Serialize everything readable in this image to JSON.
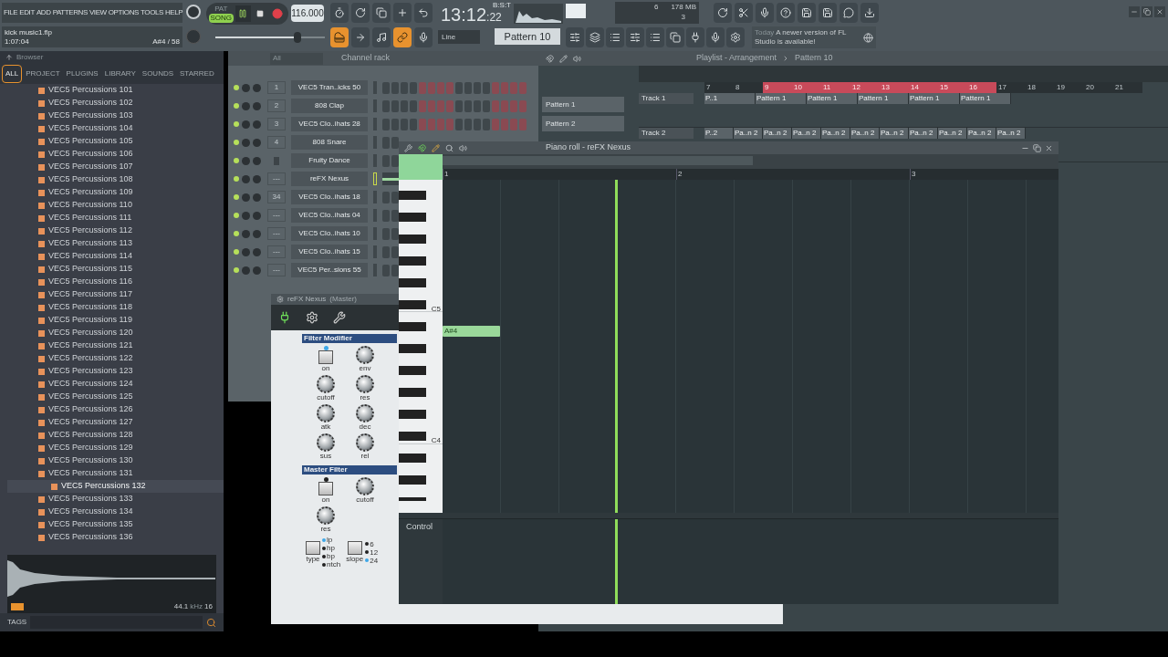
{
  "menu": [
    "FILE",
    "EDIT",
    "ADD",
    "PATTERNS",
    "VIEW",
    "OPTIONS",
    "TOOLS",
    "HELP"
  ],
  "project": {
    "file": "kick music1.flp",
    "time": "1:07:04",
    "note": "A#4 / 58"
  },
  "master_volume": {
    "level": 0.75
  },
  "transport": {
    "modes": [
      {
        "label": "PAT",
        "selected": false
      },
      {
        "label": "SONG",
        "selected": true
      }
    ],
    "playing": true,
    "tempo": "116.000"
  },
  "clock": {
    "main": "13:12",
    "small": ":22",
    "unit": "B:S:T"
  },
  "monitor": {
    "voices": "6",
    "memory": "178 MB",
    "poly": "3"
  },
  "snap": "Line",
  "pattern": "Pattern 10",
  "news": {
    "when": "Today",
    "text": "A newer version of FL Studio is available!"
  },
  "browser": {
    "title": "Browser",
    "tabs": [
      {
        "label": "ALL",
        "selected": true
      },
      {
        "label": "PROJECT",
        "selected": false
      },
      {
        "label": "PLUGINS",
        "selected": false
      },
      {
        "label": "LIBRARY",
        "selected": false
      },
      {
        "label": "SOUNDS",
        "selected": false
      },
      {
        "label": "STARRED",
        "selected": false
      }
    ],
    "items": [
      {
        "name": "VEC5 Percussions 101",
        "selected": false
      },
      {
        "name": "VEC5 Percussions 102",
        "selected": false
      },
      {
        "name": "VEC5 Percussions 103",
        "selected": false
      },
      {
        "name": "VEC5 Percussions 104",
        "selected": false
      },
      {
        "name": "VEC5 Percussions 105",
        "selected": false
      },
      {
        "name": "VEC5 Percussions 106",
        "selected": false
      },
      {
        "name": "VEC5 Percussions 107",
        "selected": false
      },
      {
        "name": "VEC5 Percussions 108",
        "selected": false
      },
      {
        "name": "VEC5 Percussions 109",
        "selected": false
      },
      {
        "name": "VEC5 Percussions 110",
        "selected": false
      },
      {
        "name": "VEC5 Percussions 111",
        "selected": false
      },
      {
        "name": "VEC5 Percussions 112",
        "selected": false
      },
      {
        "name": "VEC5 Percussions 113",
        "selected": false
      },
      {
        "name": "VEC5 Percussions 114",
        "selected": false
      },
      {
        "name": "VEC5 Percussions 115",
        "selected": false
      },
      {
        "name": "VEC5 Percussions 116",
        "selected": false
      },
      {
        "name": "VEC5 Percussions 117",
        "selected": false
      },
      {
        "name": "VEC5 Percussions 118",
        "selected": false
      },
      {
        "name": "VEC5 Percussions 119",
        "selected": false
      },
      {
        "name": "VEC5 Percussions 120",
        "selected": false
      },
      {
        "name": "VEC5 Percussions 121",
        "selected": false
      },
      {
        "name": "VEC5 Percussions 122",
        "selected": false
      },
      {
        "name": "VEC5 Percussions 123",
        "selected": false
      },
      {
        "name": "VEC5 Percussions 124",
        "selected": false
      },
      {
        "name": "VEC5 Percussions 125",
        "selected": false
      },
      {
        "name": "VEC5 Percussions 126",
        "selected": false
      },
      {
        "name": "VEC5 Percussions 127",
        "selected": false
      },
      {
        "name": "VEC5 Percussions 128",
        "selected": false
      },
      {
        "name": "VEC5 Percussions 129",
        "selected": false
      },
      {
        "name": "VEC5 Percussions 130",
        "selected": false
      },
      {
        "name": "VEC5 Percussions 131",
        "selected": false
      },
      {
        "name": "VEC5 Percussions 132",
        "selected": true
      },
      {
        "name": "VEC5 Percussions 133",
        "selected": false
      },
      {
        "name": "VEC5 Percussions 134",
        "selected": false
      },
      {
        "name": "VEC5 Percussions 135",
        "selected": false
      },
      {
        "name": "VEC5 Percussions 136",
        "selected": false
      }
    ],
    "sample": {
      "rate": "44.1",
      "unit": "kHz",
      "bits": "16"
    },
    "tags": "TAGS"
  },
  "channel_rack": {
    "filter": "All",
    "title": "Channel rack",
    "channels": [
      {
        "number": "1",
        "name": "VEC5 Tran..icks 50",
        "kind": "steps",
        "steps": [
          false,
          false,
          false,
          false,
          true,
          true,
          true,
          true,
          false,
          false,
          false,
          false,
          true,
          true,
          true,
          true
        ]
      },
      {
        "number": "2",
        "name": "808 Clap",
        "kind": "steps",
        "steps": [
          false,
          false,
          false,
          false,
          true,
          true,
          true,
          true,
          false,
          false,
          false,
          false,
          true,
          true,
          true,
          true
        ]
      },
      {
        "number": "3",
        "name": "VEC5 Clo..ihats 28",
        "kind": "steps",
        "steps": [
          false,
          false,
          false,
          false,
          true,
          true,
          true,
          true,
          false,
          false,
          false,
          false,
          true,
          true,
          true,
          true
        ]
      },
      {
        "number": "4",
        "name": "808 Snare",
        "kind": "steps",
        "steps": [
          false,
          false
        ]
      },
      {
        "name": "Fruity Dance",
        "kind": "steps",
        "steps": [
          false,
          false
        ]
      },
      {
        "number": "---",
        "name": "reFX Nexus",
        "kind": "roll"
      },
      {
        "number": "34",
        "name": "VEC5 Clo..ihats 18",
        "kind": "steps",
        "steps": [
          false,
          false
        ]
      },
      {
        "number": "---",
        "name": "VEC5 Clo..ihats 04",
        "kind": "steps",
        "steps": [
          false,
          false
        ]
      },
      {
        "number": "---",
        "name": "VEC5 Clo..ihats 10",
        "kind": "steps",
        "steps": [
          false,
          false
        ]
      },
      {
        "number": "---",
        "name": "VEC5 Clo..ihats 15",
        "kind": "steps",
        "steps": [
          false,
          false
        ]
      },
      {
        "number": "---",
        "name": "VEC5 Per..sions 55",
        "kind": "steps",
        "steps": [
          false,
          false
        ]
      }
    ]
  },
  "playlist": {
    "title": "Playlist - Arrangement",
    "pattern": "Pattern 10",
    "patterns": [
      "Pattern 1",
      "Pattern 2"
    ],
    "ruler": [
      "7",
      "8",
      "9",
      "10",
      "11",
      "12",
      "13",
      "14",
      "15",
      "16",
      "17",
      "18",
      "19",
      "20",
      "21"
    ],
    "tracks": [
      {
        "name": "Track 1",
        "clips": [
          "P..1",
          "Pattern 1",
          "Pattern 1",
          "Pattern 1",
          "Pattern 1",
          "Pattern 1"
        ]
      },
      {
        "name": "Track 2",
        "clips": [
          "P..2",
          "Pa..n 2",
          "Pa..n 2",
          "Pa..n 2",
          "Pa..n 2",
          "Pa..n 2",
          "Pa..n 2",
          "Pa..n 2",
          "Pa..n 2",
          "Pa..n 2",
          "Pa..n 2"
        ]
      }
    ]
  },
  "piano_roll": {
    "title": "Piano roll - reFX Nexus",
    "bars": [
      "1",
      "2",
      "3"
    ],
    "octaves": [
      "C5",
      "C4"
    ],
    "note": "A#4",
    "control": "Control"
  },
  "plugin": {
    "title": "reFX Nexus",
    "target": "(Master)",
    "sections": [
      {
        "title": "Filter Modifier",
        "controls": [
          {
            "label": "on",
            "kind": "button",
            "lit": true
          },
          {
            "label": "env",
            "kind": "knob"
          },
          {
            "label": "cutoff",
            "kind": "knob"
          },
          {
            "label": "res",
            "kind": "knob"
          },
          {
            "label": "atk",
            "kind": "knob"
          },
          {
            "label": "dec",
            "kind": "knob"
          },
          {
            "label": "sus",
            "kind": "knob"
          },
          {
            "label": "rel",
            "kind": "knob"
          }
        ]
      },
      {
        "title": "Master Filter",
        "controls": [
          {
            "label": "on",
            "kind": "button",
            "lit": false
          },
          {
            "label": "cutoff",
            "kind": "knob"
          },
          {
            "label": "res",
            "kind": "knob"
          }
        ],
        "selectors": [
          {
            "label": "type",
            "options": [
              {
                "label": "lp",
                "selected": true
              },
              {
                "label": "hp",
                "selected": false
              },
              {
                "label": "bp",
                "selected": false
              },
              {
                "label": "ntch",
                "selected": false
              }
            ]
          },
          {
            "label": "slope",
            "options": [
              {
                "label": "6",
                "selected": false
              },
              {
                "label": "12",
                "selected": false
              },
              {
                "label": "24",
                "selected": true
              }
            ]
          }
        ]
      }
    ]
  }
}
